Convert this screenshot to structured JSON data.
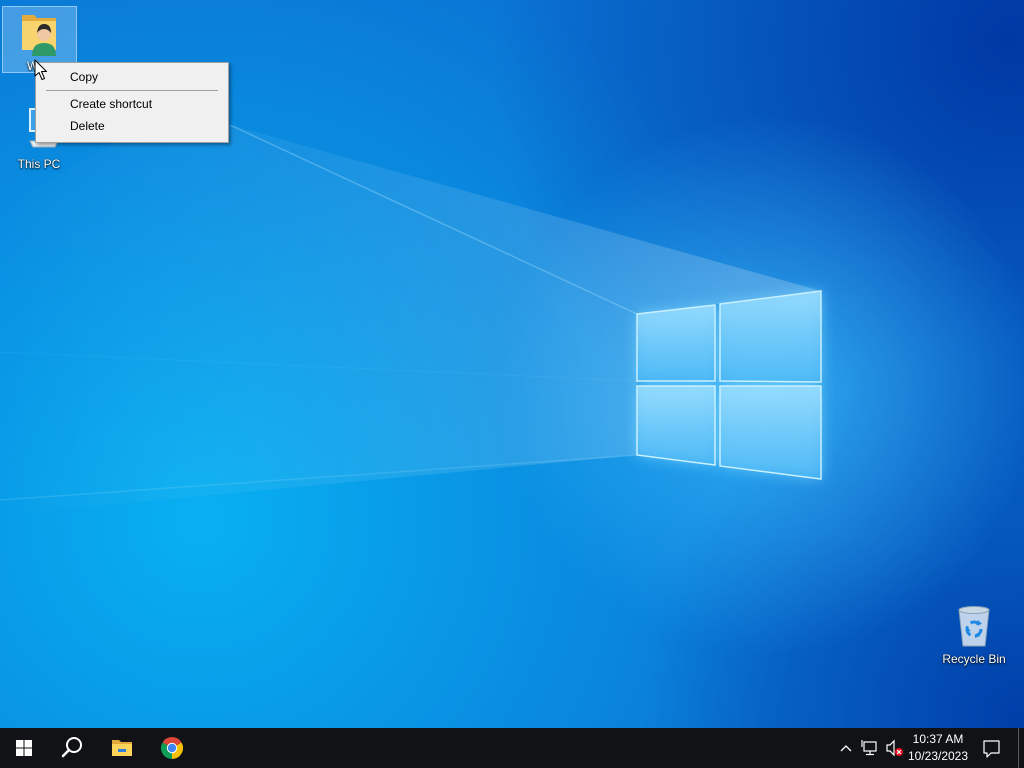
{
  "desktop": {
    "icons": [
      {
        "label": "W",
        "icon": "user-folder-icon",
        "selected": true
      },
      {
        "label": "This PC",
        "icon": "this-pc-icon",
        "selected": false
      },
      {
        "label": "Recycle Bin",
        "icon": "recycle-bin-icon",
        "selected": false
      }
    ]
  },
  "context_menu": {
    "items": [
      {
        "label": "Copy"
      },
      {
        "label": "Create shortcut"
      },
      {
        "label": "Delete"
      }
    ]
  },
  "taskbar": {
    "pinned": [
      {
        "icon": "windows-start-icon"
      },
      {
        "icon": "search-icon"
      },
      {
        "icon": "file-explorer-icon"
      },
      {
        "icon": "chrome-icon"
      }
    ],
    "tray": {
      "icons": [
        "chevron-up-icon",
        "network-icon",
        "volume-muted-icon",
        "notification-icon"
      ],
      "time": "10:37 AM",
      "date": "10/23/2023"
    }
  },
  "colors": {
    "accent": "#0078d7",
    "taskbar": "#101216",
    "menu_background": "#f0f0f0",
    "muted_badge": "#e81123"
  }
}
